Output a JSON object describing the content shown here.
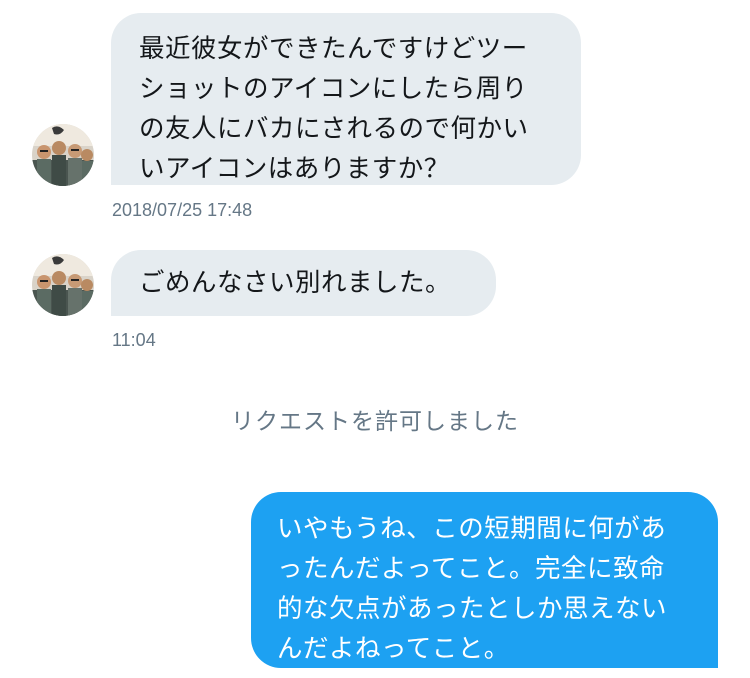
{
  "conversation": {
    "messages": [
      {
        "direction": "incoming",
        "text": "最近彼女ができたんですけどツー\nショットのアイコンにしたら周り\nの友人にバカにされるので何かい\nいアイコンはありますか？",
        "timestamp": "2018/07/25 17:48",
        "avatar_icon": "group-photo-avatar"
      },
      {
        "direction": "incoming",
        "text": "ごめんなさい別れました。",
        "timestamp": "11:04",
        "avatar_icon": "group-photo-avatar"
      },
      {
        "direction": "outgoing",
        "text": "いやもうね、この短期間に何があ\nったんだよってこと。完全に致命\n的な欠点があったとしか思えない\nんだよねってこと。"
      }
    ],
    "system_note": "リクエストを許可しました"
  },
  "colors": {
    "incoming_bubble": "#e6ecf0",
    "outgoing_bubble": "#1da1f2",
    "timestamp_text": "#657786"
  }
}
